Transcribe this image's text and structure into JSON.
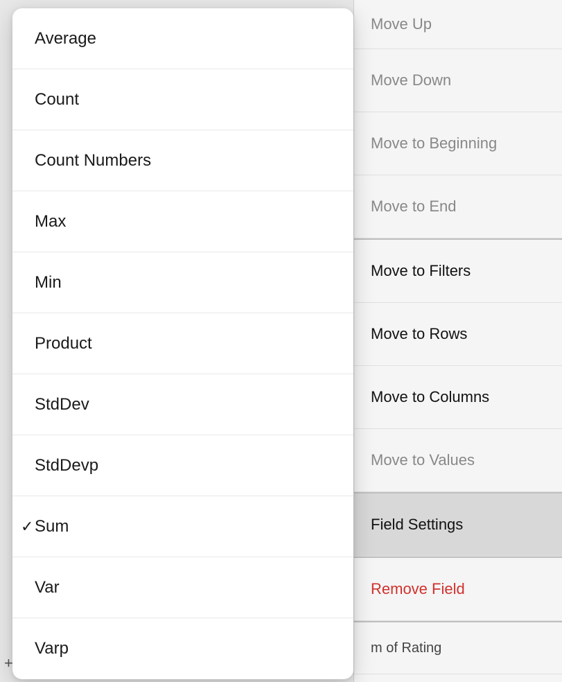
{
  "background_menu": {
    "items": [
      {
        "id": "move-up",
        "label": "Move Up",
        "style": "muted",
        "height": 71
      },
      {
        "id": "move-down",
        "label": "Move Down",
        "style": "muted",
        "height": 91
      },
      {
        "id": "move-to-beginning",
        "label": "Move to Beginning",
        "style": "muted",
        "height": 91
      },
      {
        "id": "move-to-end",
        "label": "Move to End",
        "style": "muted",
        "height": 91
      },
      {
        "id": "separator",
        "type": "separator"
      },
      {
        "id": "move-to-filters",
        "label": "Move to Filters",
        "style": "bold",
        "height": 91
      },
      {
        "id": "move-to-rows",
        "label": "Move to Rows",
        "style": "bold",
        "height": 91
      },
      {
        "id": "move-to-columns",
        "label": "Move to Columns",
        "style": "bold",
        "height": 91
      },
      {
        "id": "move-to-values",
        "label": "Move to Values",
        "style": "muted",
        "height": 91
      },
      {
        "id": "separator2",
        "type": "separator"
      },
      {
        "id": "field-settings",
        "label": "Field Settings",
        "style": "highlighted",
        "height": 91
      },
      {
        "id": "separator3",
        "type": "separator"
      },
      {
        "id": "remove-field",
        "label": "Remove Field",
        "style": "red",
        "height": 91
      },
      {
        "id": "separator4",
        "type": "separator"
      },
      {
        "id": "sum-of-rating",
        "label": "m of Rating",
        "style": "last",
        "height": 75
      }
    ]
  },
  "dropdown_menu": {
    "items": [
      {
        "id": "average",
        "label": "Average",
        "checked": false
      },
      {
        "id": "count",
        "label": "Count",
        "checked": false
      },
      {
        "id": "count-numbers",
        "label": "Count Numbers",
        "checked": false
      },
      {
        "id": "max",
        "label": "Max",
        "checked": false
      },
      {
        "id": "min",
        "label": "Min",
        "checked": false
      },
      {
        "id": "product",
        "label": "Product",
        "checked": false
      },
      {
        "id": "stddev",
        "label": "StdDev",
        "checked": false
      },
      {
        "id": "stddevp",
        "label": "StdDevp",
        "checked": false
      },
      {
        "id": "sum",
        "label": "Sum",
        "checked": true
      },
      {
        "id": "var",
        "label": "Var",
        "checked": false
      },
      {
        "id": "varp",
        "label": "Varp",
        "checked": false
      }
    ],
    "check_symbol": "✓"
  },
  "bottom_text": "m of Rating",
  "plus_label": "+"
}
